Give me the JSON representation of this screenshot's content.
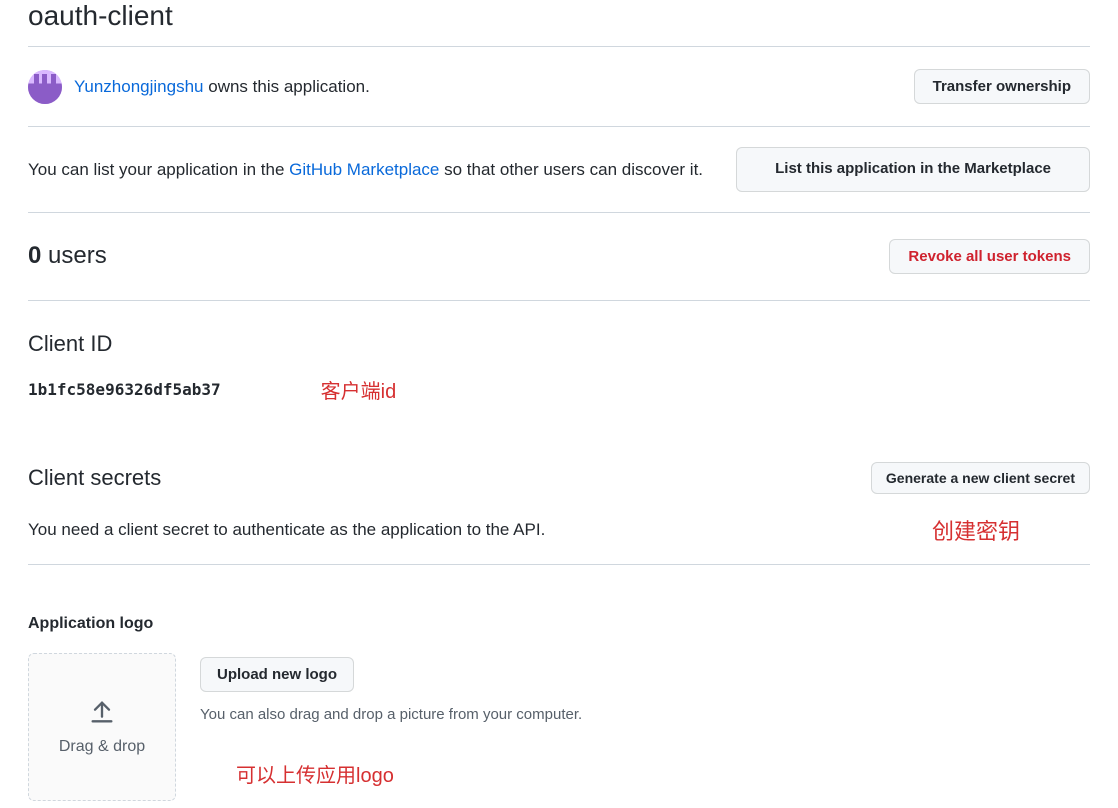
{
  "app": {
    "title": "oauth-client"
  },
  "owner": {
    "username": "Yunzhongjingshu",
    "owns_text": " owns this application.",
    "transfer_button": "Transfer ownership"
  },
  "marketplace": {
    "text_before": "You can list your application in the ",
    "link_text": "GitHub Marketplace",
    "text_after": " so that other users can discover it.",
    "list_button": "List this application in the Marketplace"
  },
  "users": {
    "count": "0",
    "label": " users",
    "revoke_button": "Revoke all user tokens"
  },
  "client_id": {
    "heading": "Client ID",
    "value": "1b1fc58e96326df5ab37",
    "annotation": "客户端id"
  },
  "secrets": {
    "heading": "Client secrets",
    "generate_button": "Generate a new client secret",
    "description": "You need a client secret to authenticate as the application to the API.",
    "annotation": "创建密钥"
  },
  "logo": {
    "label": "Application logo",
    "dropzone_text": "Drag & drop",
    "upload_button": "Upload new logo",
    "hint": "You can also drag and drop a picture from your computer.",
    "annotation": "可以上传应用logo"
  }
}
